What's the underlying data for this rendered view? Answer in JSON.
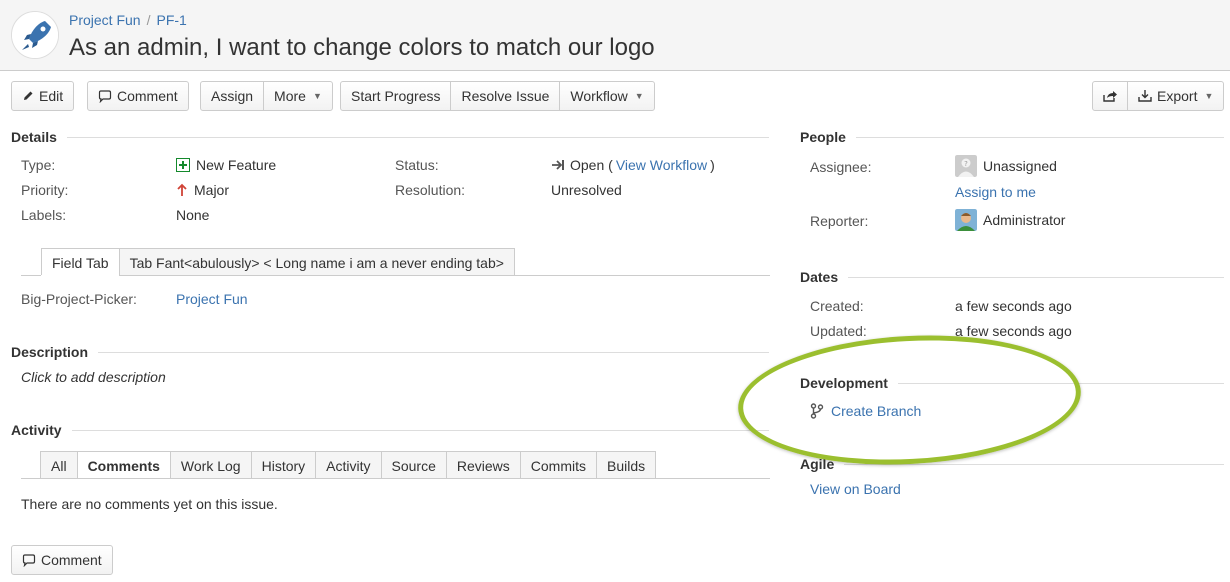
{
  "header": {
    "project": "Project Fun",
    "separator": "/",
    "issue_key": "PF-1",
    "title": "As an admin, I want to change colors to match our logo"
  },
  "toolbar": {
    "edit": "Edit",
    "comment": "Comment",
    "assign": "Assign",
    "more": "More",
    "start_progress": "Start Progress",
    "resolve_issue": "Resolve Issue",
    "workflow": "Workflow",
    "export": "Export"
  },
  "details": {
    "heading": "Details",
    "type_label": "Type:",
    "type_value": "New Feature",
    "priority_label": "Priority:",
    "priority_value": "Major",
    "labels_label": "Labels:",
    "labels_value": "None",
    "status_label": "Status:",
    "status_value": "Open (",
    "status_link": "View Workflow",
    "status_close": ")",
    "resolution_label": "Resolution:",
    "resolution_value": "Unresolved"
  },
  "field_tabs": {
    "tab1": "Field Tab",
    "tab2": "Tab Fant<abulously> < Long name i am a never ending tab>"
  },
  "custom_field": {
    "label": "Big-Project-Picker:",
    "value": "Project Fun"
  },
  "description": {
    "heading": "Description",
    "placeholder": "Click to add description"
  },
  "activity": {
    "heading": "Activity",
    "tabs": [
      "All",
      "Comments",
      "Work Log",
      "History",
      "Activity",
      "Source",
      "Reviews",
      "Commits",
      "Builds"
    ],
    "empty": "There are no comments yet on this issue.",
    "comment_button": "Comment"
  },
  "people": {
    "heading": "People",
    "assignee_label": "Assignee:",
    "assignee_value": "Unassigned",
    "assign_to_me": "Assign to me",
    "reporter_label": "Reporter:",
    "reporter_value": "Administrator"
  },
  "dates": {
    "heading": "Dates",
    "created_label": "Created:",
    "created_value": "a few seconds ago",
    "updated_label": "Updated:",
    "updated_value": "a few seconds ago"
  },
  "development": {
    "heading": "Development",
    "create_branch": "Create Branch"
  },
  "agile": {
    "heading": "Agile",
    "view_on_board": "View on Board"
  },
  "colors": {
    "link": "#3b73af",
    "highlight": "#9bbf2f",
    "priority_arrow": "#d04437",
    "new_feature": "#14892c"
  }
}
